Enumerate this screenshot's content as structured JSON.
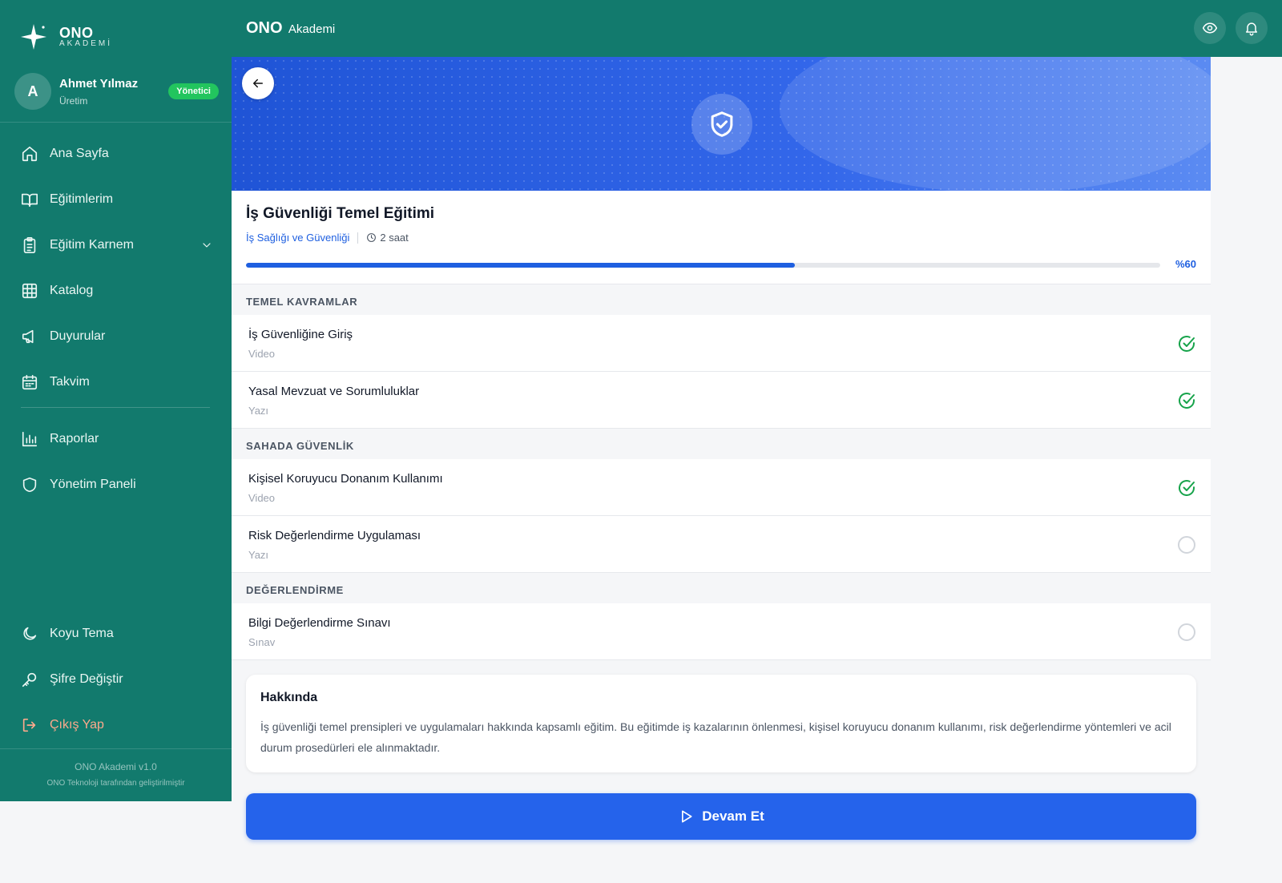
{
  "brand": {
    "name": "ONO",
    "subtitle": "AKADEMİ"
  },
  "user": {
    "initial": "A",
    "name": "Ahmet Yılmaz",
    "department": "Üretim",
    "role": "Yönetici"
  },
  "nav": {
    "home": "Ana Sayfa",
    "trainings": "Eğitimlerim",
    "report_card": "Eğitim Karnem",
    "catalog": "Katalog",
    "announcements": "Duyurular",
    "calendar": "Takvim",
    "reports": "Raporlar",
    "admin_panel": "Yönetim Paneli",
    "dark_theme": "Koyu Tema",
    "change_password": "Şifre Değiştir",
    "logout": "Çıkış Yap"
  },
  "footer": {
    "version": "ONO Akademi v1.0",
    "credit": "ONO Teknoloji tarafından geliştirilmiştir"
  },
  "topbar": {
    "title_bold": "ONO",
    "title_rest": "Akademi"
  },
  "course": {
    "title": "İş Güvenliği Temel Eğitimi",
    "category": "İş Sağlığı ve Güvenliği",
    "duration": "2 saat",
    "progress": 60,
    "progress_label": "%60"
  },
  "sections": [
    {
      "title": "TEMEL KAVRAMLAR",
      "lessons": [
        {
          "name": "İş Güvenliğine Giriş",
          "type": "Video",
          "completed": true
        },
        {
          "name": "Yasal Mevzuat ve Sorumluluklar",
          "type": "Yazı",
          "completed": true
        }
      ]
    },
    {
      "title": "SAHADA GÜVENLİK",
      "lessons": [
        {
          "name": "Kişisel Koruyucu Donanım Kullanımı",
          "type": "Video",
          "completed": true
        },
        {
          "name": "Risk Değerlendirme Uygulaması",
          "type": "Yazı",
          "completed": false
        }
      ]
    },
    {
      "title": "DEĞERLENDİRME",
      "lessons": [
        {
          "name": "Bilgi Değerlendirme Sınavı",
          "type": "Sınav",
          "completed": false
        }
      ]
    }
  ],
  "about": {
    "title": "Hakkında",
    "text": "İş güvenliği temel prensipleri ve uygulamaları hakkında kapsamlı eğitim. Bu eğitimde iş kazalarının önlenmesi, kişisel koruyucu donanım kullanımı, risk değerlendirme yöntemleri ve acil durum prosedürleri ele alınmaktadır."
  },
  "cta": {
    "label": "Devam Et"
  },
  "colors": {
    "sidebar": "#127a6d",
    "primary": "#2563eb",
    "success": "#16a34a",
    "logout": "#fca98c"
  }
}
